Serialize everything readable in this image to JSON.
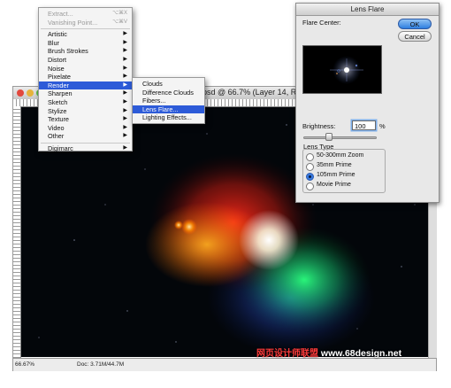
{
  "document": {
    "title": "psd @ 66.7% (Layer 14, RGB/8)",
    "zoom": "66.67%",
    "doc_size": "Doc: 3.71M/44.7M",
    "traffic_colors": [
      "#e2483d",
      "#e6b33b",
      "#5ab845"
    ]
  },
  "filter_menu": {
    "items": [
      {
        "label": "Extract...",
        "shortcut": "⌥⌘X",
        "dim": true
      },
      {
        "label": "Vanishing Point...",
        "shortcut": "⌥⌘V",
        "dim": true
      },
      {
        "label": "Artistic",
        "arrow": "▶"
      },
      {
        "label": "Blur",
        "arrow": "▶"
      },
      {
        "label": "Brush Strokes",
        "arrow": "▶"
      },
      {
        "label": "Distort",
        "arrow": "▶"
      },
      {
        "label": "Noise",
        "arrow": "▶"
      },
      {
        "label": "Pixelate",
        "arrow": "▶"
      },
      {
        "label": "Render",
        "arrow": "▶",
        "selected": true
      },
      {
        "label": "Sharpen",
        "arrow": "▶"
      },
      {
        "label": "Sketch",
        "arrow": "▶"
      },
      {
        "label": "Stylize",
        "arrow": "▶"
      },
      {
        "label": "Texture",
        "arrow": "▶"
      },
      {
        "label": "Video",
        "arrow": "▶"
      },
      {
        "label": "Other",
        "arrow": "▶"
      },
      {
        "label": "Digimarc",
        "arrow": "▶"
      }
    ]
  },
  "render_submenu": {
    "items": [
      {
        "label": "Clouds"
      },
      {
        "label": "Difference Clouds"
      },
      {
        "label": "Fibers..."
      },
      {
        "label": "Lens Flare...",
        "selected": true
      },
      {
        "label": "Lighting Effects..."
      }
    ]
  },
  "lens_flare_dialog": {
    "title": "Lens Flare",
    "flare_center_label": "Flare Center:",
    "ok_label": "OK",
    "cancel_label": "Cancel",
    "brightness_label": "Brightness:",
    "brightness_value": "100",
    "brightness_unit": "%",
    "brightness_fraction": 0.35,
    "lens_type_label": "Lens Type",
    "lens_types": [
      {
        "label": "50-300mm Zoom",
        "selected": false
      },
      {
        "label": "35mm Prime",
        "selected": false
      },
      {
        "label": "105mm Prime",
        "selected": true
      },
      {
        "label": "Movie Prime",
        "selected": false
      }
    ]
  },
  "watermark": {
    "cn": "网页设计师联盟",
    "url": "www.68design.net"
  }
}
